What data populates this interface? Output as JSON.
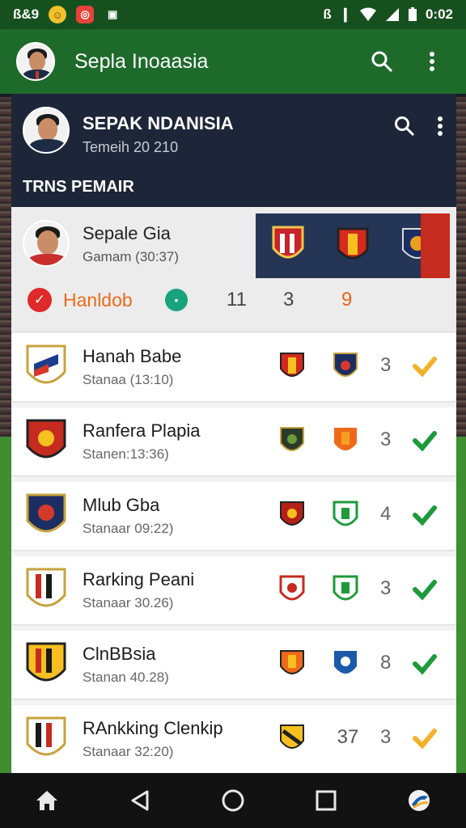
{
  "status_bar": {
    "left_text": "ß&9",
    "time": "0:02",
    "icons": [
      "notification-icon",
      "app-icon",
      "image-icon",
      "bluetooth-icon",
      "vibrate-icon",
      "wifi-icon",
      "signal-icon",
      "battery-icon"
    ]
  },
  "app_bar": {
    "title": "Sepla Inoaasia",
    "search_icon": "search-icon",
    "menu_icon": "more-vert-icon"
  },
  "card_header": {
    "title": "SEPAK NDANISIA",
    "subtitle": "Temeih 20 210",
    "section_label": "TRNS PEMAIR"
  },
  "featured": {
    "name": "Sepale Gia",
    "sub": "Gamam (30:37)",
    "highlight_label": "Hanldob",
    "stat_1": "11",
    "stat_2": "3",
    "stat_3": "9"
  },
  "teams": [
    {
      "name": "Hanah Babe",
      "sub": "Stanaa (13:10)",
      "b2_text": "",
      "count": "3",
      "check": "orange"
    },
    {
      "name": "Ranfera Plapia",
      "sub": "Stanen:13:36)",
      "b2_text": "",
      "count": "3",
      "check": "green"
    },
    {
      "name": "Mlub Gba",
      "sub": "Stanaar 09:22)",
      "b2_text": "",
      "count": "4",
      "check": "green"
    },
    {
      "name": "Rarking Peani",
      "sub": "Stanaar 30.26)",
      "b2_text": "",
      "count": "3",
      "check": "green"
    },
    {
      "name": "ClnBBsia",
      "sub": "Stanan 40.28)",
      "b2_text": "",
      "count": "8",
      "check": "green"
    },
    {
      "name": "RAnkking Clenkip",
      "sub": "Stanaar 32:20)",
      "b2_text": "37",
      "count": "3",
      "check": "orange"
    }
  ],
  "nav_bar": {
    "icons": [
      "home-icon",
      "back-icon",
      "home-circle-icon",
      "recents-icon",
      "app-logo-icon"
    ]
  },
  "colors": {
    "green_bar": "#1e6a2b",
    "dark_header": "#1d2538",
    "orange_accent": "#ee6a1a",
    "check_green": "#1e9a3a",
    "check_orange": "#f3b12a"
  }
}
